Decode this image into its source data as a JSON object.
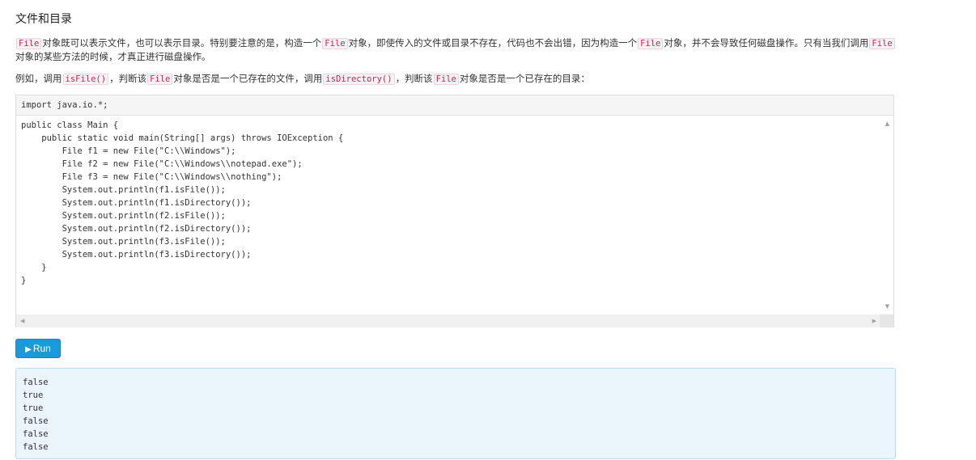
{
  "heading": "文件和目录",
  "para1": {
    "t1": "File",
    "t2": "对象既可以表示文件，也可以表示目录。特别要注意的是，构造一个",
    "t3": "File",
    "t4": "对象，即使传入的文件或目录不存在，代码也不会出错，因为构造一个",
    "t5": "File",
    "t6": "对象，并不会导致任何磁盘操作。只有当我们调用",
    "t7": "File",
    "t8": "对象的某些方法的时候，才真正进行磁盘操作。"
  },
  "para2": {
    "t1": "例如，调用",
    "t2": "isFile()",
    "t3": "，判断该",
    "t4": "File",
    "t5": "对象是否是一个已存在的文件，调用",
    "t6": "isDirectory()",
    "t7": "，判断该",
    "t8": "File",
    "t9": "对象是否是一个已存在的目录："
  },
  "editor": {
    "header_code": "import java.io.*;",
    "code": "public class Main {\n    public static void main(String[] args) throws IOException {\n        File f1 = new File(\"C:\\\\Windows\");\n        File f2 = new File(\"C:\\\\Windows\\\\notepad.exe\");\n        File f3 = new File(\"C:\\\\Windows\\\\nothing\");\n        System.out.println(f1.isFile());\n        System.out.println(f1.isDirectory());\n        System.out.println(f2.isFile());\n        System.out.println(f2.isDirectory());\n        System.out.println(f3.isFile());\n        System.out.println(f3.isDirectory());\n    }\n}"
  },
  "run_button": {
    "icon": "play-icon",
    "label": "Run"
  },
  "output": "false\ntrue\ntrue\nfalse\nfalse\nfalse"
}
